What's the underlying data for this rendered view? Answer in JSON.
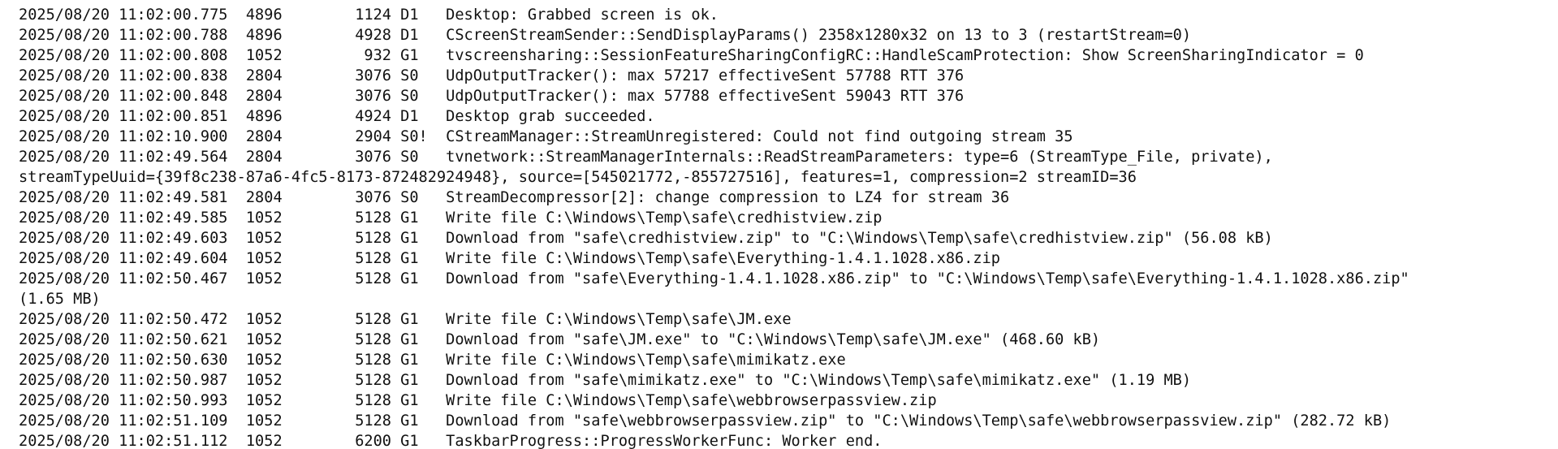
{
  "log": {
    "lines": [
      "2025/08/20 11:02:00.775  4896        1124 D1   Desktop: Grabbed screen is ok.",
      "2025/08/20 11:02:00.788  4896        4928 D1   CScreenStreamSender::SendDisplayParams() 2358x1280x32 on 13 to 3 (restartStream=0)",
      "2025/08/20 11:02:00.808  1052         932 G1   tvscreensharing::SessionFeatureSharingConfigRC::HandleScamProtection: Show ScreenSharingIndicator = 0",
      "2025/08/20 11:02:00.838  2804        3076 S0   UdpOutputTracker(): max 57217 effectiveSent 57788 RTT 376",
      "2025/08/20 11:02:00.848  2804        3076 S0   UdpOutputTracker(): max 57788 effectiveSent 59043 RTT 376",
      "2025/08/20 11:02:00.851  4896        4924 D1   Desktop grab succeeded.",
      "2025/08/20 11:02:10.900  2804        2904 S0!  CStreamManager::StreamUnregistered: Could not find outgoing stream 35",
      "2025/08/20 11:02:49.564  2804        3076 S0   tvnetwork::StreamManagerInternals::ReadStreamParameters: type=6 (StreamType_File, private),",
      "streamTypeUuid={39f8c238-87a6-4fc5-8173-872482924948}, source=[545021772,-855727516], features=1, compression=2 streamID=36",
      "2025/08/20 11:02:49.581  2804        3076 S0   StreamDecompressor[2]: change compression to LZ4 for stream 36",
      "2025/08/20 11:02:49.585  1052        5128 G1   Write file C:\\Windows\\Temp\\safe\\credhistview.zip",
      "2025/08/20 11:02:49.603  1052        5128 G1   Download from \"safe\\credhistview.zip\" to \"C:\\Windows\\Temp\\safe\\credhistview.zip\" (56.08 kB)",
      "2025/08/20 11:02:49.604  1052        5128 G1   Write file C:\\Windows\\Temp\\safe\\Everything-1.4.1.1028.x86.zip",
      "2025/08/20 11:02:50.467  1052        5128 G1   Download from \"safe\\Everything-1.4.1.1028.x86.zip\" to \"C:\\Windows\\Temp\\safe\\Everything-1.4.1.1028.x86.zip\"",
      "(1.65 MB)",
      "2025/08/20 11:02:50.472  1052        5128 G1   Write file C:\\Windows\\Temp\\safe\\JM.exe",
      "2025/08/20 11:02:50.621  1052        5128 G1   Download from \"safe\\JM.exe\" to \"C:\\Windows\\Temp\\safe\\JM.exe\" (468.60 kB)",
      "2025/08/20 11:02:50.630  1052        5128 G1   Write file C:\\Windows\\Temp\\safe\\mimikatz.exe",
      "2025/08/20 11:02:50.987  1052        5128 G1   Download from \"safe\\mimikatz.exe\" to \"C:\\Windows\\Temp\\safe\\mimikatz.exe\" (1.19 MB)",
      "2025/08/20 11:02:50.993  1052        5128 G1   Write file C:\\Windows\\Temp\\safe\\webbrowserpassview.zip",
      "2025/08/20 11:02:51.109  1052        5128 G1   Download from \"safe\\webbrowserpassview.zip\" to \"C:\\Windows\\Temp\\safe\\webbrowserpassview.zip\" (282.72 kB)",
      "2025/08/20 11:02:51.112  1052        6200 G1   TaskbarProgress::ProgressWorkerFunc: Worker end."
    ]
  }
}
